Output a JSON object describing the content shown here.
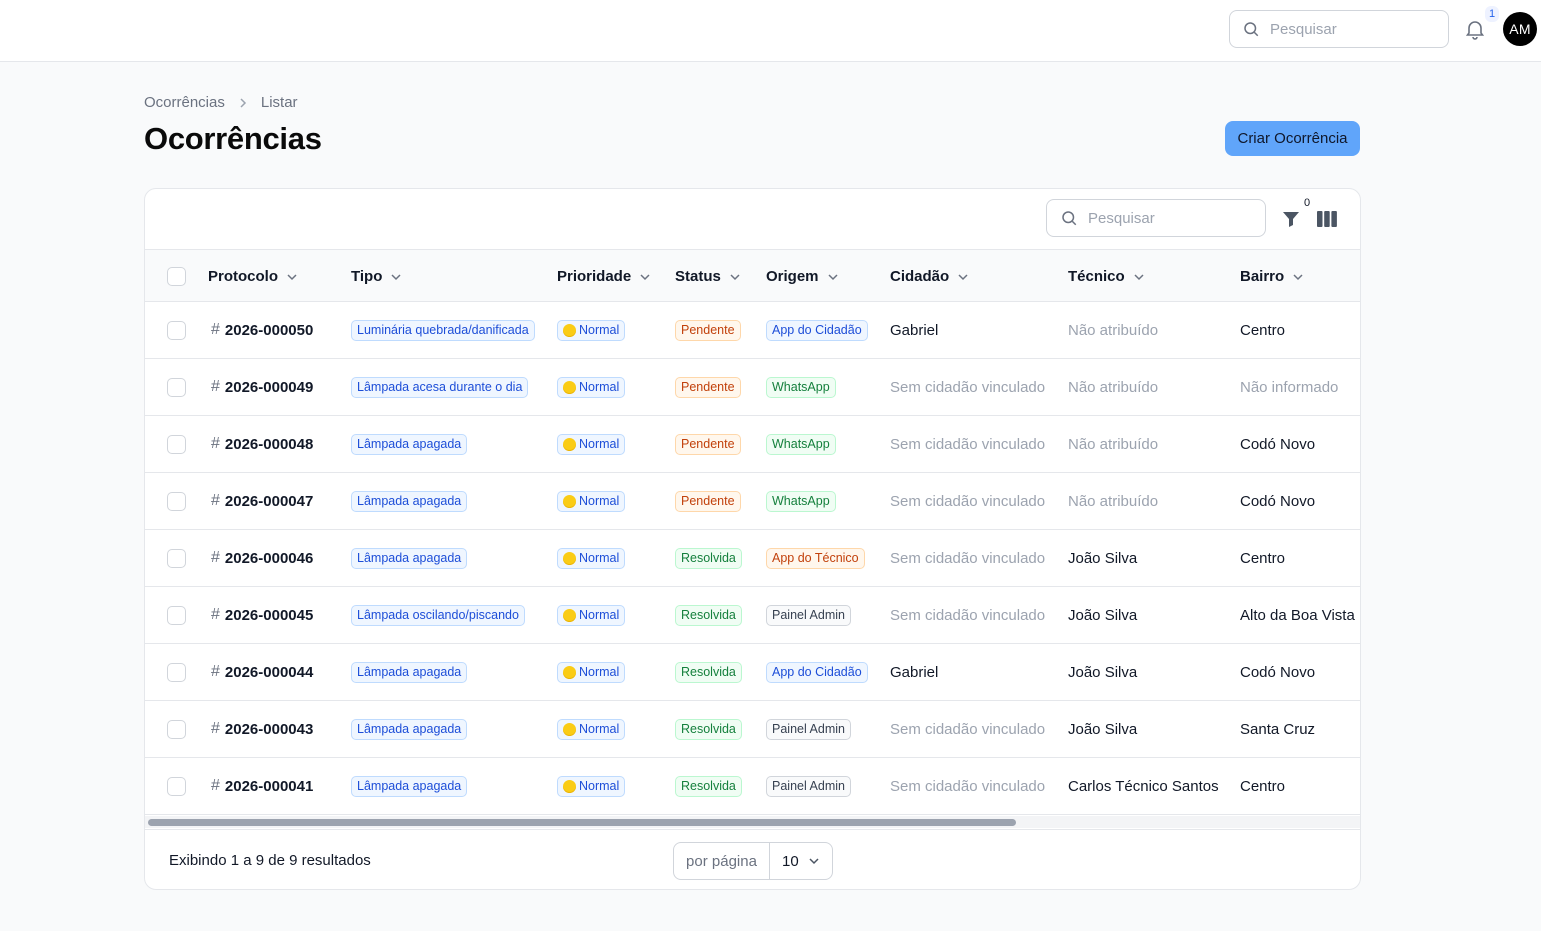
{
  "topbar": {
    "search_placeholder": "Pesquisar",
    "notification_count": "1",
    "avatar_initials": "AM"
  },
  "breadcrumb": {
    "items": [
      "Ocorrências",
      "Listar"
    ]
  },
  "page": {
    "title": "Ocorrências",
    "create_button": "Criar Ocorrência"
  },
  "table": {
    "search_placeholder": "Pesquisar",
    "filter_count": "0",
    "columns": [
      "Protocolo",
      "Tipo",
      "Prioridade",
      "Status",
      "Origem",
      "Cidadão",
      "Técnico",
      "Bairro"
    ],
    "rows": [
      {
        "protocolo": "2026-000050",
        "tipo": "Luminária quebrada/danificada",
        "prioridade": "Normal",
        "status": "Pendente",
        "origem": "App do Cidadão",
        "cidadao": "Gabriel",
        "tecnico": "Não atribuído",
        "bairro": "Centro"
      },
      {
        "protocolo": "2026-000049",
        "tipo": "Lâmpada acesa durante o dia",
        "prioridade": "Normal",
        "status": "Pendente",
        "origem": "WhatsApp",
        "cidadao": "Sem cidadão vinculado",
        "tecnico": "Não atribuído",
        "bairro": "Não informado"
      },
      {
        "protocolo": "2026-000048",
        "tipo": "Lâmpada apagada",
        "prioridade": "Normal",
        "status": "Pendente",
        "origem": "WhatsApp",
        "cidadao": "Sem cidadão vinculado",
        "tecnico": "Não atribuído",
        "bairro": "Codó Novo"
      },
      {
        "protocolo": "2026-000047",
        "tipo": "Lâmpada apagada",
        "prioridade": "Normal",
        "status": "Pendente",
        "origem": "WhatsApp",
        "cidadao": "Sem cidadão vinculado",
        "tecnico": "Não atribuído",
        "bairro": "Codó Novo"
      },
      {
        "protocolo": "2026-000046",
        "tipo": "Lâmpada apagada",
        "prioridade": "Normal",
        "status": "Resolvida",
        "origem": "App do Técnico",
        "cidadao": "Sem cidadão vinculado",
        "tecnico": "João Silva",
        "bairro": "Centro"
      },
      {
        "protocolo": "2026-000045",
        "tipo": "Lâmpada oscilando/piscando",
        "prioridade": "Normal",
        "status": "Resolvida",
        "origem": "Painel Admin",
        "cidadao": "Sem cidadão vinculado",
        "tecnico": "João Silva",
        "bairro": "Alto da Boa Vista"
      },
      {
        "protocolo": "2026-000044",
        "tipo": "Lâmpada apagada",
        "prioridade": "Normal",
        "status": "Resolvida",
        "origem": "App do Cidadão",
        "cidadao": "Gabriel",
        "tecnico": "João Silva",
        "bairro": "Codó Novo"
      },
      {
        "protocolo": "2026-000043",
        "tipo": "Lâmpada apagada",
        "prioridade": "Normal",
        "status": "Resolvida",
        "origem": "Painel Admin",
        "cidadao": "Sem cidadão vinculado",
        "tecnico": "João Silva",
        "bairro": "Santa Cruz"
      },
      {
        "protocolo": "2026-000041",
        "tipo": "Lâmpada apagada",
        "prioridade": "Normal",
        "status": "Resolvida",
        "origem": "Painel Admin",
        "cidadao": "Sem cidadão vinculado",
        "tecnico": "Carlos Técnico Santos",
        "bairro": "Centro"
      }
    ],
    "footer": {
      "results_text": "Exibindo 1 a 9 de 9 resultados",
      "per_page_label": "por página",
      "per_page_value": "10"
    }
  },
  "colors": {
    "primary_button": "#60a5fa",
    "pending": "#c2410c",
    "resolved": "#15803d",
    "info": "#1d4ed8"
  }
}
